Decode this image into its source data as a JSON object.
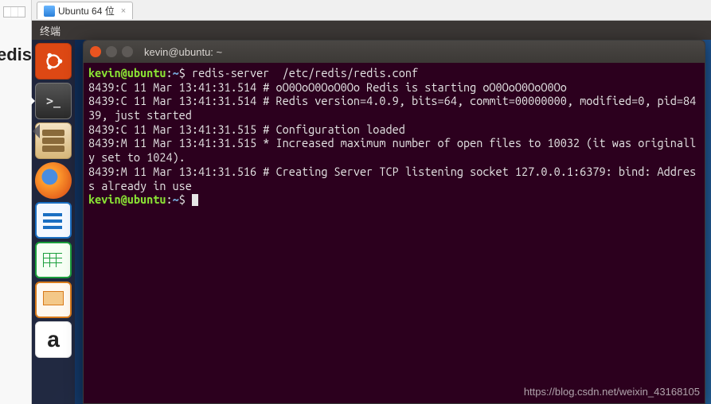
{
  "side_text": "edis",
  "vm_tab": {
    "label": "Ubuntu 64 位",
    "close": "×"
  },
  "ubuntu": {
    "topbar_label": "终端"
  },
  "launcher": [
    {
      "name": "ubuntu-dash"
    },
    {
      "name": "terminal",
      "active": true
    },
    {
      "name": "files"
    },
    {
      "name": "firefox"
    },
    {
      "name": "libreoffice-writer"
    },
    {
      "name": "libreoffice-calc"
    },
    {
      "name": "libreoffice-impress"
    },
    {
      "name": "amazon"
    }
  ],
  "terminal": {
    "title": "kevin@ubuntu: ~",
    "prompt": {
      "user": "kevin",
      "host": "ubuntu",
      "path": "~",
      "symbol": "$"
    },
    "command": "redis-server  /etc/redis/redis.conf",
    "output": [
      "8439:C 11 Mar 13:41:31.514 # oO0OoO0OoO0Oo Redis is starting oO0OoO0OoO0Oo",
      "8439:C 11 Mar 13:41:31.514 # Redis version=4.0.9, bits=64, commit=00000000, modified=0, pid=8439, just started",
      "8439:C 11 Mar 13:41:31.515 # Configuration loaded",
      "8439:M 11 Mar 13:41:31.515 * Increased maximum number of open files to 10032 (it was originally set to 1024).",
      "8439:M 11 Mar 13:41:31.516 # Creating Server TCP listening socket 127.0.0.1:6379: bind: Address already in use"
    ]
  },
  "watermark": "https://blog.csdn.net/weixin_43168105"
}
